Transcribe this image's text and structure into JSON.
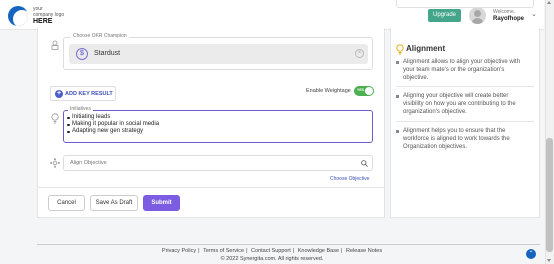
{
  "header": {
    "logo_line1": "your",
    "logo_line2": "company logo",
    "logo_line3": "HERE",
    "upgrade_label": "Upgrade",
    "welcome_label": "Welcome,",
    "user_name": "Rayofhope"
  },
  "form": {
    "champion_label": "Choose OKR Champion",
    "champion_value": "Stardust",
    "add_key_result_label": "ADD KEY RESULT",
    "weightage_label": "Enable Weightage",
    "weightage_toggle_text": "YES",
    "weightage_enabled": true,
    "initiatives_label": "Initiatives",
    "initiatives": [
      "Initiating leads",
      "Making it popular in social media",
      "Adapting new gen strategy"
    ],
    "align_placeholder": "Align Objective",
    "choose_objective_label": "Choose Objective"
  },
  "actions": {
    "cancel_label": "Cancel",
    "save_draft_label": "Save As Draft",
    "submit_label": "Submit"
  },
  "sidebar": {
    "title": "Alignment",
    "points": [
      "Alignment allows to align your objective with your team mate's or the organization's objective.",
      "Aligning your objective will create better visibility on how you are contributing to the organization's objective.",
      "Alignment helps you to ensure that the workforce is aligned to work towards the Organization objectives."
    ]
  },
  "footer": {
    "links": [
      "Privacy Policy",
      "Terms of Service",
      "Contact Support",
      "Knowledge Base",
      "Release Notes"
    ],
    "copyright": "© 2022 Synergita.com. All rights reserved."
  },
  "colors": {
    "brand_blue": "#1565c0",
    "upgrade_green": "#43a58a",
    "accent_purple": "#7c5ce0",
    "toggle_green": "#4caf50",
    "link_blue": "#3f51b5"
  }
}
